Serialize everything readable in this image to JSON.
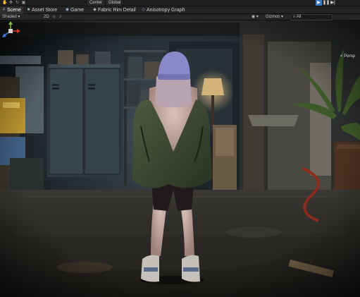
{
  "toolbar": {
    "center_pill_1": "Center",
    "center_pill_2": "Global",
    "play_icons": [
      "play-icon",
      "pause-icon",
      "step-icon"
    ]
  },
  "tabs": [
    {
      "label": "Scene",
      "icon": "scene-icon",
      "active": true
    },
    {
      "label": "Asset Store",
      "icon": "store-icon",
      "active": false
    },
    {
      "label": "Game",
      "icon": "game-icon",
      "active": false
    },
    {
      "label": "Fabric Rim Detail",
      "icon": "material-icon",
      "active": false
    },
    {
      "label": "Anisotropy Graph",
      "icon": "graph-icon",
      "active": false
    }
  ],
  "subbar": {
    "shading_mode": "Shaded",
    "gizmos_label": "Gizmos",
    "search_label": "All",
    "twod_label": "2D"
  },
  "viewport": {
    "perspective_label": "< Persp",
    "gizmo_axes": [
      "x",
      "y",
      "z"
    ]
  },
  "colors": {
    "accent": "#3b78c4",
    "axis_x": "#d13a2f",
    "axis_y": "#86c23a",
    "axis_z": "#3d78d8"
  }
}
